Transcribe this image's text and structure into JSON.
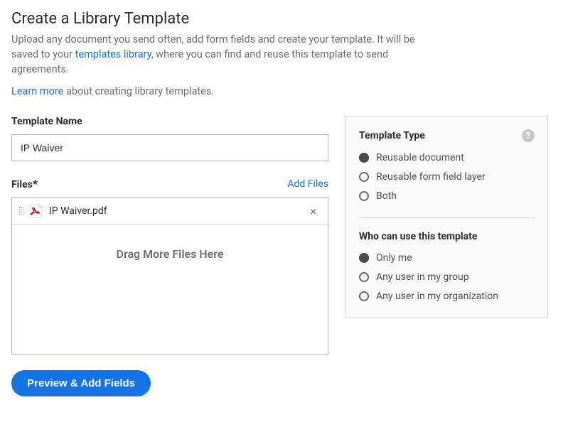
{
  "header": {
    "title": "Create a Library Template",
    "intro_pre": "Upload any document you send often, add form fields and create your template. It will be saved to your ",
    "intro_link": "templates library",
    "intro_post": ", where you can find and reuse this template to send agreements.",
    "learn_more_link": "Learn more",
    "learn_more_post": " about creating library templates."
  },
  "form": {
    "template_name_label": "Template Name",
    "template_name_value": "IP Waiver",
    "files_label": "Files",
    "files_required": "*",
    "add_files_label": "Add Files",
    "files": [
      {
        "name": "IP Waiver.pdf"
      }
    ],
    "drop_zone_text": "Drag More Files Here",
    "submit_label": "Preview & Add Fields"
  },
  "sidebar": {
    "template_type": {
      "title": "Template Type",
      "options": [
        {
          "label": "Reusable document",
          "selected": true
        },
        {
          "label": "Reusable form field layer",
          "selected": false
        },
        {
          "label": "Both",
          "selected": false
        }
      ]
    },
    "who_can_use": {
      "title": "Who can use this template",
      "options": [
        {
          "label": "Only me",
          "selected": true
        },
        {
          "label": "Any user in my group",
          "selected": false
        },
        {
          "label": "Any user in my organization",
          "selected": false
        }
      ]
    }
  }
}
